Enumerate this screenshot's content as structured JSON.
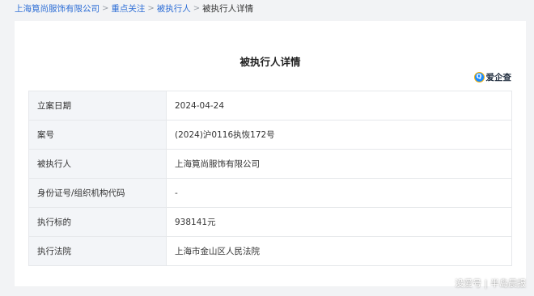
{
  "breadcrumb": {
    "items": [
      {
        "label": "上海筧尚服饰有限公司"
      },
      {
        "label": "重点关注"
      },
      {
        "label": "被执行人"
      }
    ],
    "current": "被执行人详情",
    "separator": ">"
  },
  "detail": {
    "title": "被执行人详情",
    "logo_text": "爱企查",
    "rows": [
      {
        "label": "立案日期",
        "value": "2024-04-24"
      },
      {
        "label": "案号",
        "value": "(2024)沪0116执恢172号"
      },
      {
        "label": "被执行人",
        "value": "上海筧尚服饰有限公司"
      },
      {
        "label": "身份证号/组织机构代码",
        "value": "-"
      },
      {
        "label": "执行标的",
        "value": "938141元"
      },
      {
        "label": "执行法院",
        "value": "上海市金山区人民法院"
      }
    ]
  },
  "watermark": "没爱号 | 半岛晨报",
  "colors": {
    "link": "#2f6fd6",
    "page_bg": "#f2f3f5",
    "label_bg": "#f3f5f8",
    "border": "#e6e8eb",
    "logo_blue": "#1a8cff"
  }
}
